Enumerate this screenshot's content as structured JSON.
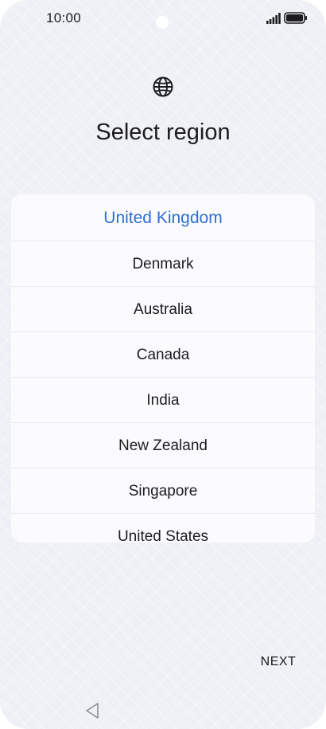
{
  "status_bar": {
    "time": "10:00",
    "signal_icon": "signal-icon",
    "battery_icon": "battery-icon"
  },
  "header": {
    "icon": "globe-icon",
    "title": "Select region"
  },
  "region_list": {
    "selected": "United Kingdom",
    "items": [
      "United Kingdom",
      "Denmark",
      "Australia",
      "Canada",
      "India",
      "New Zealand",
      "Singapore",
      "United States"
    ]
  },
  "footer": {
    "next_label": "NEXT",
    "back_icon": "back-icon"
  },
  "colors": {
    "accent": "#2f6fd6",
    "text": "#1c1c1e",
    "background": "#eef0f5",
    "card": "#fbfbfd"
  }
}
